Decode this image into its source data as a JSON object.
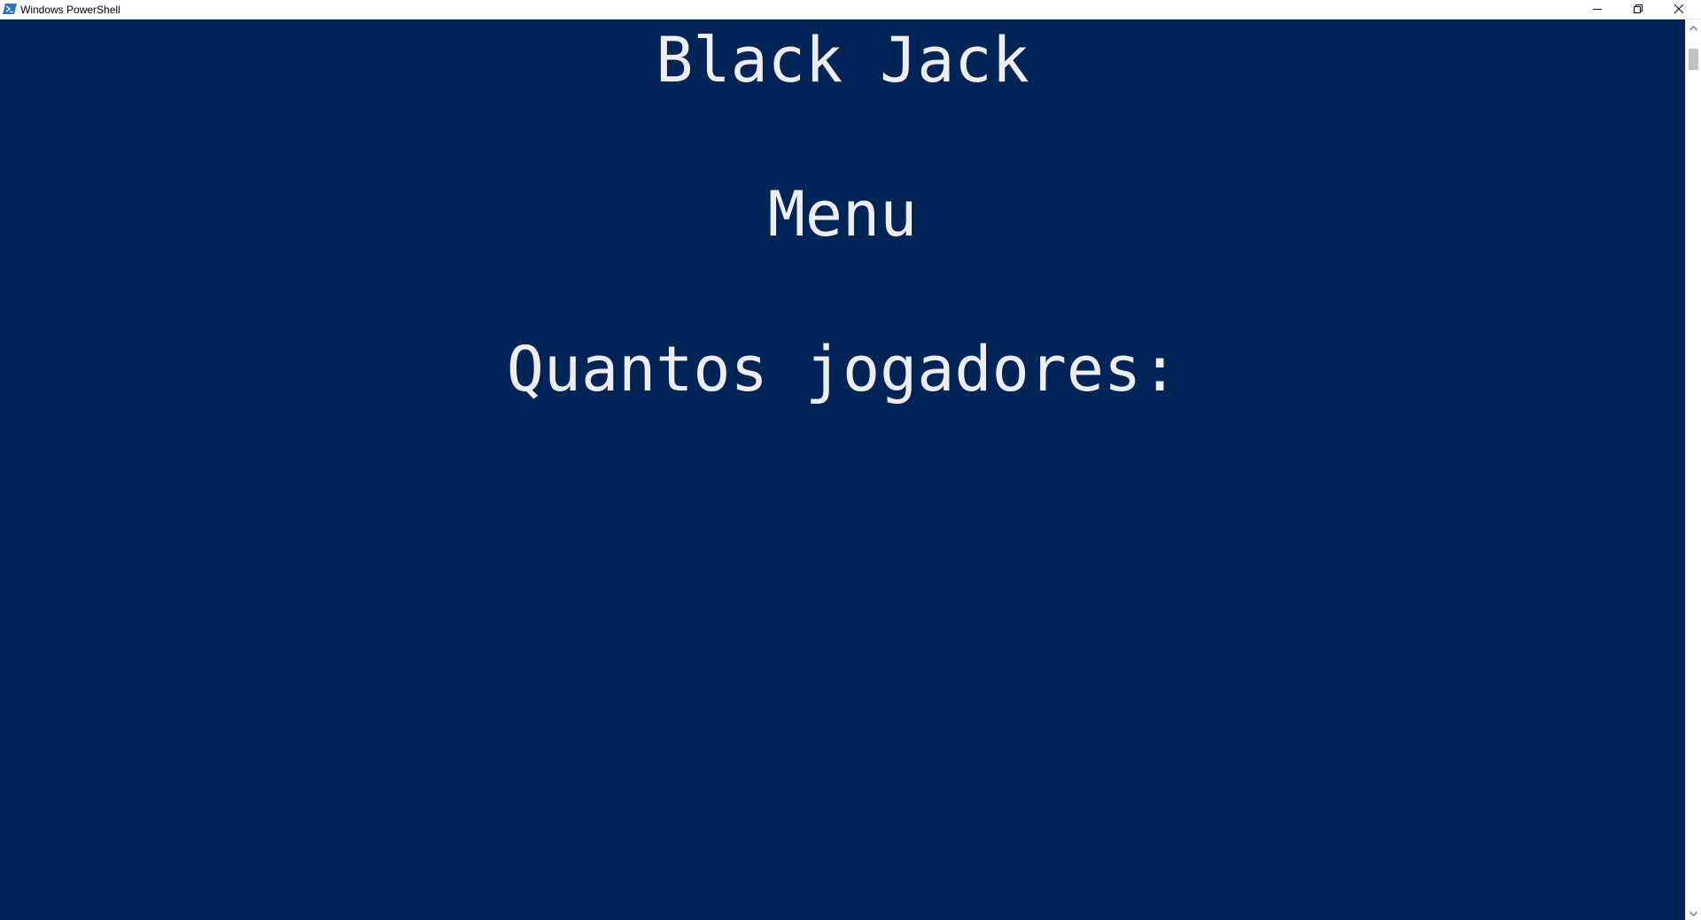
{
  "window": {
    "title": "Windows PowerShell",
    "app_icon": "powershell-icon",
    "controls": {
      "minimize_icon": "minimize-icon",
      "restore_icon": "restore-icon",
      "close_icon": "close-icon"
    }
  },
  "console": {
    "background_color": "#012456",
    "text_color": "#eeedf0",
    "lines": {
      "title": "Black Jack",
      "menu": "Menu",
      "prompt": "Quantos jogadores:"
    }
  },
  "scrollbar": {
    "up_icon": "chevron-up-icon",
    "down_icon": "chevron-down-icon"
  }
}
